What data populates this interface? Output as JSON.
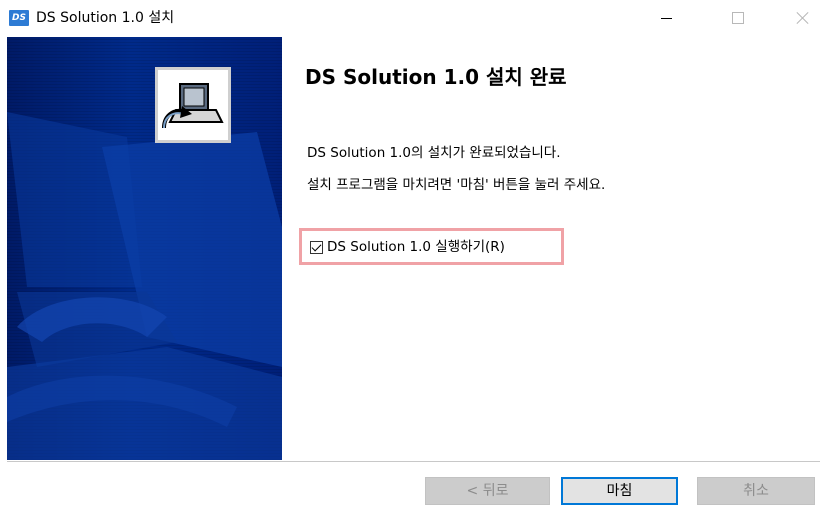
{
  "window": {
    "title": "DS Solution 1.0 설치",
    "icon_text": "DS"
  },
  "content": {
    "heading": "DS Solution 1.0 설치 완료",
    "line1": "DS Solution 1.0의 설치가 완료되었습니다.",
    "line2": "설치 프로그램을 마치려면 '마침' 버튼을 눌러 주세요.",
    "run_checkbox": {
      "label": "DS Solution 1.0 실행하기(R)",
      "checked": true
    }
  },
  "buttons": {
    "back": "< 뒤로",
    "finish": "마침",
    "cancel": "취소"
  },
  "colors": {
    "banner": "#002a8a",
    "highlight": "#f0a2a6",
    "focus": "#0078d7"
  },
  "icons": [
    "app-logo-icon",
    "minimize-icon",
    "maximize-icon",
    "close-icon",
    "installer-computer-icon",
    "checkmark-icon"
  ]
}
